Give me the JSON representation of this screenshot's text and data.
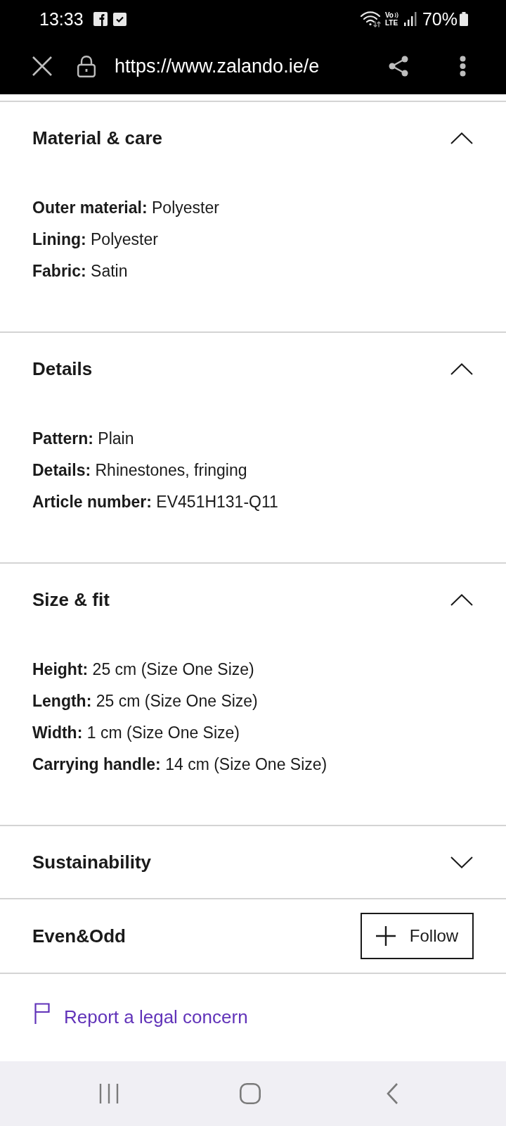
{
  "status_bar": {
    "time": "13:33",
    "volte_top": "Vo",
    "volte_bottom": "LTE",
    "battery": "70%"
  },
  "browser_bar": {
    "url": "https://www.zalando.ie/e"
  },
  "sections": [
    {
      "title": "Material & care",
      "expanded": true,
      "items": [
        "**Outer material:** Polyester",
        "**Lining:** Polyester",
        "**Fabric:** Satin"
      ]
    },
    {
      "title": "Details",
      "expanded": true,
      "items": [
        "**Pattern:** Plain",
        "**Details:** Rhinestones, fringing",
        "**Article number:** EV451H131-Q11"
      ]
    },
    {
      "title": "Size & fit",
      "expanded": true,
      "items": [
        "**Height:** 25 cm (Size One Size)",
        "**Length:** 25 cm (Size One Size)",
        "**Width:** 1 cm (Size One Size)",
        "**Carrying handle:** 14 cm (Size One Size)"
      ]
    },
    {
      "title": "Sustainability",
      "expanded": false
    }
  ],
  "brand": {
    "name": "Even&Odd",
    "follow_button": {
      "label": "Follow"
    }
  },
  "report_link": {
    "label": "Report a legal concern"
  }
}
